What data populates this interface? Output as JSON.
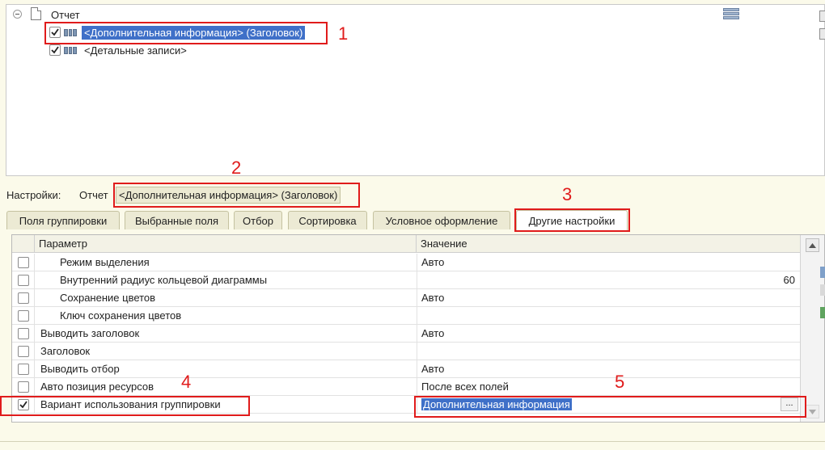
{
  "tree": {
    "root_label": "Отчет",
    "items": [
      {
        "label": "<Дополнительная информация> (Заголовок)",
        "checked": true,
        "selected": true
      },
      {
        "label": "<Детальные записи>",
        "checked": true,
        "selected": false
      }
    ]
  },
  "settings": {
    "label": "Настройки:",
    "path_prefix": "Отчет",
    "current": "<Дополнительная информация> (Заголовок)"
  },
  "tabs": [
    {
      "label": "Поля группировки"
    },
    {
      "label": "Выбранные поля"
    },
    {
      "label": "Отбор"
    },
    {
      "label": "Сортировка"
    },
    {
      "label": "Условное оформление"
    },
    {
      "label": "Другие настройки",
      "active": true
    }
  ],
  "grid": {
    "columns": {
      "param": "Параметр",
      "value": "Значение"
    },
    "rows": [
      {
        "param": "Режим выделения",
        "value": "Авто",
        "checked": false,
        "indent": true
      },
      {
        "param": "Внутренний радиус кольцевой диаграммы",
        "value": "",
        "number": "60",
        "checked": false,
        "indent": true
      },
      {
        "param": "Сохранение цветов",
        "value": "Авто",
        "checked": false,
        "indent": true
      },
      {
        "param": "Ключ сохранения цветов",
        "value": "",
        "checked": false,
        "indent": true
      },
      {
        "param": "Выводить заголовок",
        "value": "Авто",
        "checked": false,
        "indent": false
      },
      {
        "param": "Заголовок",
        "value": "",
        "checked": false,
        "indent": false
      },
      {
        "param": "Выводить отбор",
        "value": "Авто",
        "checked": false,
        "indent": false
      },
      {
        "param": "Авто позиция ресурсов",
        "value": "После всех полей",
        "checked": false,
        "indent": false
      },
      {
        "param": "Вариант использования группировки",
        "value": "Дополнительная информация",
        "checked": true,
        "indent": false,
        "selected": true,
        "ellipsis": "..."
      }
    ]
  },
  "annotations": [
    "1",
    "2",
    "3",
    "4",
    "5"
  ],
  "colors": {
    "annotation": "#e01b1b",
    "selection": "#3f70c8",
    "background": "#fbfaea"
  }
}
